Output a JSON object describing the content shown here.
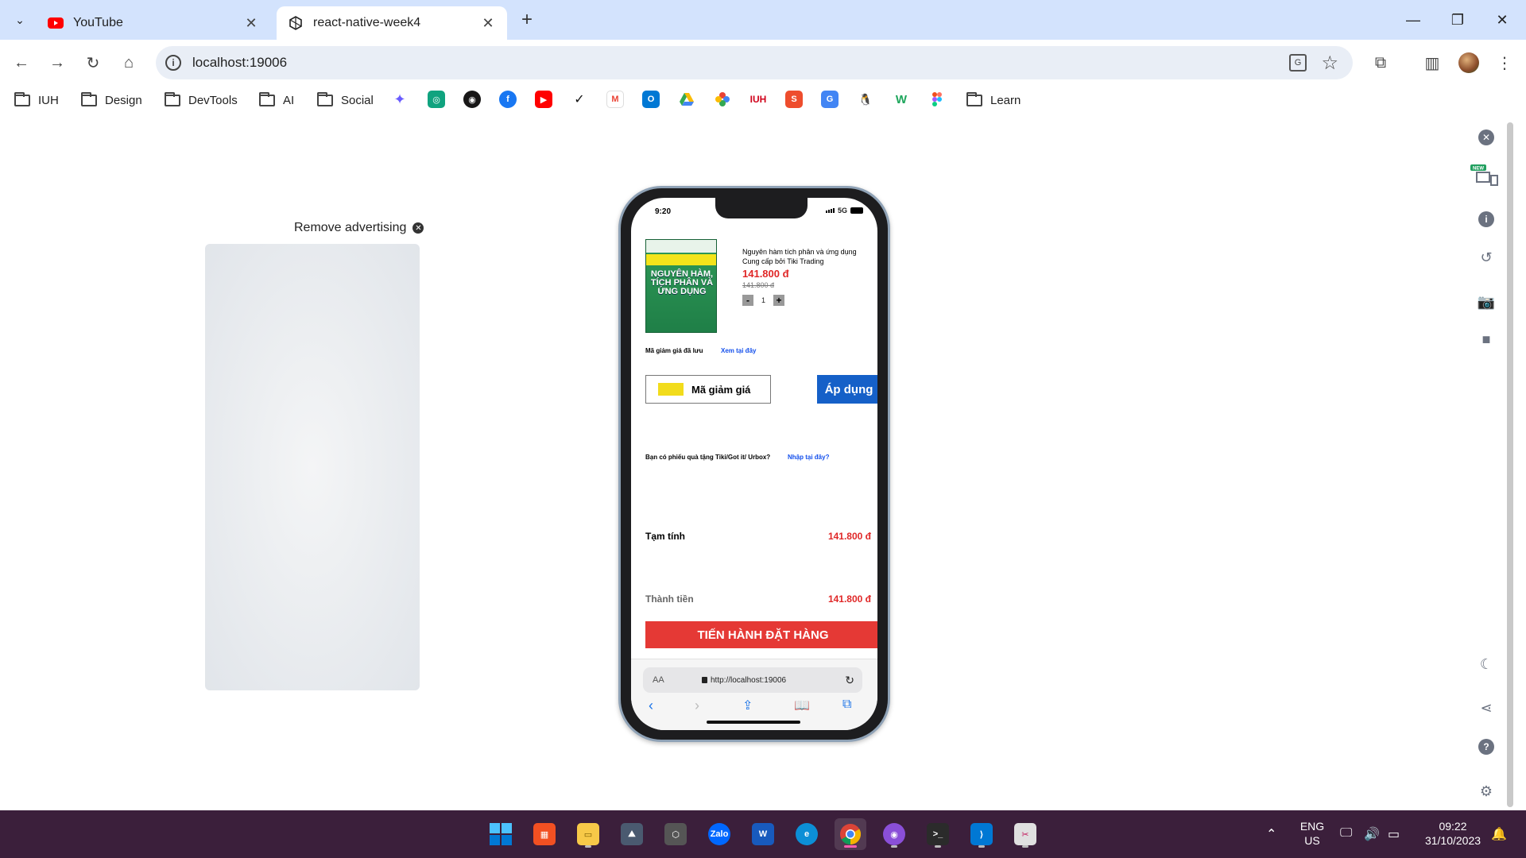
{
  "browser": {
    "tabs": [
      {
        "title": "YouTube"
      },
      {
        "title": "react-native-week4"
      }
    ],
    "url": "localhost:19006",
    "bookmarks": {
      "folders": [
        "IUH",
        "Design",
        "DevTools",
        "AI",
        "Social",
        "Learn"
      ]
    }
  },
  "ad": {
    "remove_label": "Remove advertising"
  },
  "phone": {
    "status_time": "9:20",
    "network": "5G",
    "product": {
      "title": "Nguyên hàm tích phân và ứng dụng",
      "seller": "Cung cấp bởi Tiki Trading",
      "price": "141.800 đ",
      "old_price": "141.800 đ",
      "quantity": "1",
      "cover_title": "NGUYÊN HÀM, TÍCH PHÂN VÀ ỨNG DỤNG"
    },
    "coupon": {
      "saved_label": "Mã giảm giá đã lưu",
      "view_link": "Xem tại đây",
      "input_label": "Mã giảm giá",
      "apply_label": "Áp dụng"
    },
    "gift": {
      "question": "Bạn có phiếu quà tặng Tiki/Got it/ Urbox?",
      "link": "Nhập tại đây?"
    },
    "subtotal": {
      "label": "Tạm tính",
      "value": "141.800 đ"
    },
    "total": {
      "label": "Thành tiền",
      "value": "141.800 đ"
    },
    "order_button": "TIẾN HÀNH ĐẶT HÀNG",
    "safari": {
      "aa": "AA",
      "url": "http://localhost:19006"
    }
  },
  "taskbar": {
    "lang_line1": "ENG",
    "lang_line2": "US",
    "time": "09:22",
    "date": "31/10/2023"
  }
}
